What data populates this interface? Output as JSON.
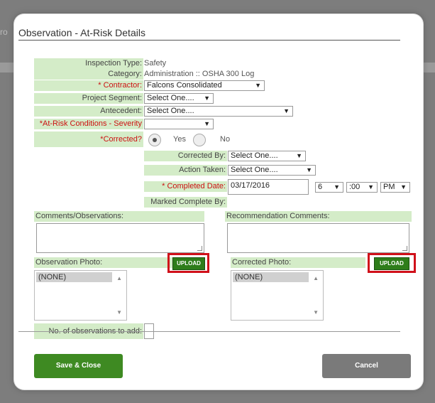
{
  "background": {
    "left_fragment": "ro"
  },
  "dialog": {
    "title": "Observation - At-Risk Details",
    "fields": {
      "inspection_type": {
        "label": "Inspection Type:",
        "value": "Safety"
      },
      "category": {
        "label": "Category:",
        "value": "Administration :: OSHA 300 Log"
      },
      "contractor": {
        "label": "* Contractor:",
        "value": "Falcons Consolidated"
      },
      "project_segment": {
        "label": "Project Segment:",
        "value": "Select One...."
      },
      "antecedent": {
        "label": "Antecedent:",
        "value": "Select One...."
      },
      "severity": {
        "label": "*At-Risk Conditions - Severity",
        "value": ""
      },
      "corrected": {
        "label": "*Corrected?",
        "yes": "Yes",
        "no": "No",
        "selected": "Yes"
      },
      "corrected_by": {
        "label": "Corrected By:",
        "value": "Select One...."
      },
      "action_taken": {
        "label": "Action Taken:",
        "value": "Select One...."
      },
      "completed_date": {
        "label": "* Completed Date:",
        "value": "03/17/2016",
        "hour": "6",
        "minute": ":00",
        "ampm": "PM"
      },
      "marked_complete_by": {
        "label": "Marked Complete By:"
      }
    },
    "comments_label": "Comments/Observations:",
    "recommendation_label": "Recommendation Comments:",
    "observation_photo_label": "Observation Photo:",
    "corrected_photo_label": "Corrected Photo:",
    "upload_label": "UPLOAD",
    "none_option": "(NONE)",
    "num_observations_label": "No. of observations to add:",
    "save_label": "Save & Close",
    "cancel_label": "Cancel"
  },
  "colors": {
    "label_bg": "#d4ecc8",
    "required_text": "#cc1111",
    "upload_green": "#2e7d1a",
    "highlight_red": "#d0101a",
    "save_green": "#3e8a22",
    "cancel_gray": "#7a7a7a"
  }
}
